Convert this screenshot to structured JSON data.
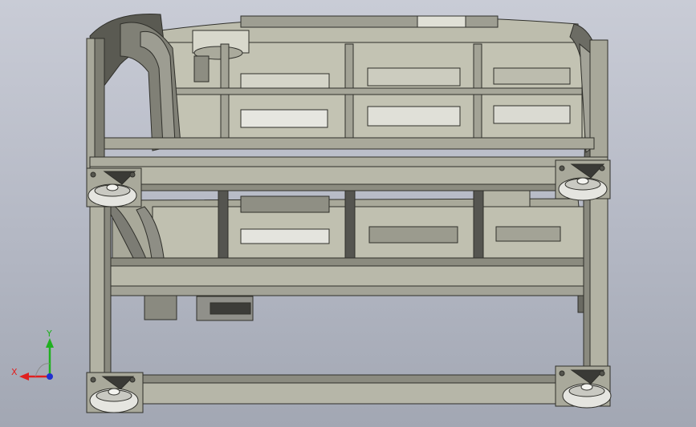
{
  "viewport": {
    "background_top": "#c9ccd6",
    "background_bottom": "#a2a7b3"
  },
  "model": {
    "frame_color": "#b9b9aa",
    "frame_dark": "#4a4a44",
    "tray_color": "#c2c2b2",
    "shadow_color": "#6e6e66",
    "caster_color": "#e7e7e2"
  },
  "triad": {
    "x_label": "X",
    "y_label": "Y",
    "x_color": "#e02020",
    "y_color": "#20b020",
    "z_color": "#2030d0"
  }
}
